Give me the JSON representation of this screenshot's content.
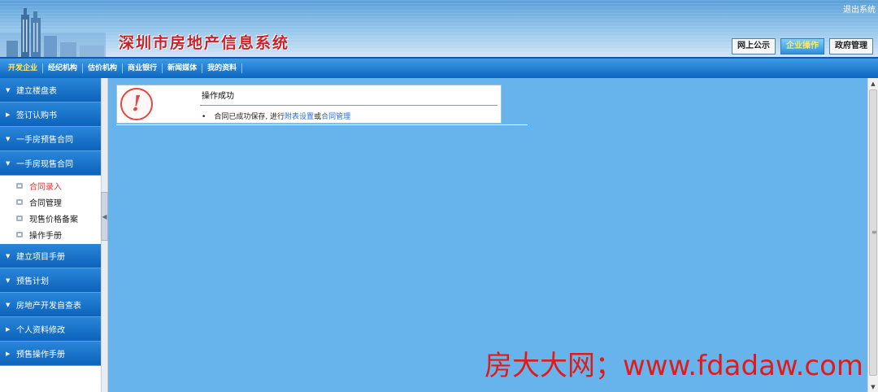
{
  "header": {
    "site_title": "深圳市房地产信息系统",
    "logout_label": "退出系统",
    "tabs": [
      {
        "label": "网上公示"
      },
      {
        "label": "企业操作"
      },
      {
        "label": "政府管理"
      }
    ]
  },
  "nav": {
    "items": [
      {
        "label": "开发企业"
      },
      {
        "label": "经纪机构"
      },
      {
        "label": "估价机构"
      },
      {
        "label": "商业银行"
      },
      {
        "label": "新闻媒体"
      },
      {
        "label": "我的资料"
      }
    ]
  },
  "sidebar": {
    "items": [
      {
        "label": "建立楼盘表"
      },
      {
        "label": "签订认购书"
      },
      {
        "label": "一手房预售合同"
      },
      {
        "label": "一手房现售合同"
      },
      {
        "label": "建立项目手册"
      },
      {
        "label": "预售计划"
      },
      {
        "label": "房地产开发自查表"
      },
      {
        "label": "个人资料修改"
      },
      {
        "label": "预售操作手册"
      }
    ],
    "sub_items": [
      {
        "label": "合同录入"
      },
      {
        "label": "合同管理"
      },
      {
        "label": "现售价格备案"
      },
      {
        "label": "操作手册"
      }
    ]
  },
  "message": {
    "title": "操作成功",
    "bullet": "•",
    "text_before": "合同已成功保存, 进行",
    "link1": "附表设置",
    "text_mid": "或",
    "link2": "合同管理"
  },
  "watermark": "房大大网；www.fdadaw.com",
  "colors": {
    "header_blue": "#5a9fd8",
    "nav_blue": "#0c66c0",
    "main_bg": "#67b4ec",
    "title_red": "#c8232c",
    "active_yellow": "#ffe95a",
    "link_blue": "#2c6fc6"
  }
}
